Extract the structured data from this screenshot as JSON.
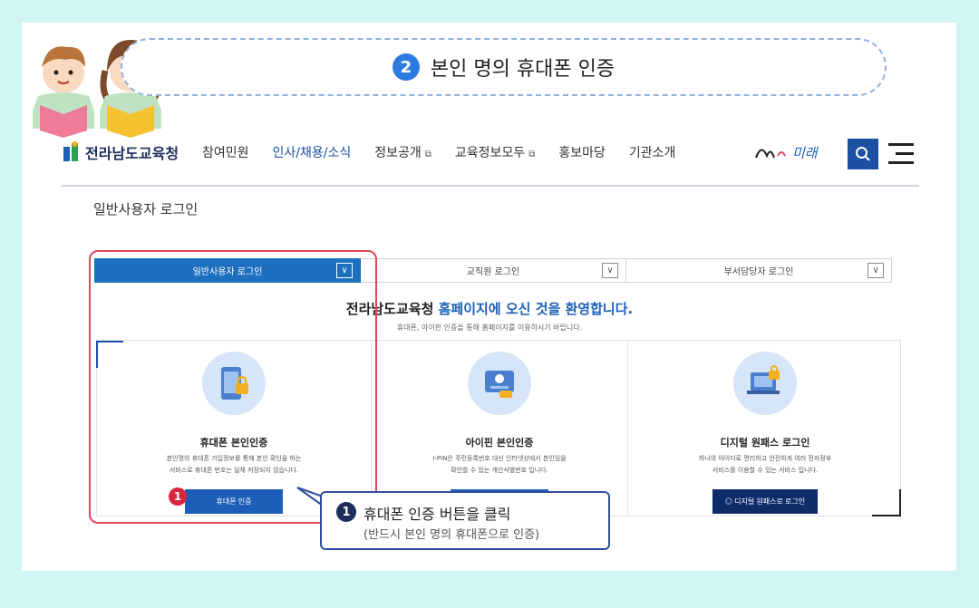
{
  "step": {
    "number": "2",
    "title": "본인 명의 휴대폰 인증"
  },
  "header": {
    "logo_text": "전라남도교육청",
    "nav": [
      {
        "label": "참여민원"
      },
      {
        "label": "인사/채용/소식"
      },
      {
        "label": "정보공개"
      },
      {
        "label": "교육정보모두"
      },
      {
        "label": "홍보마당"
      },
      {
        "label": "기관소개"
      }
    ],
    "brand_text": "미래"
  },
  "page_title": "일반사용자 로그인",
  "tabs": [
    {
      "label": "일반사용자 로그인"
    },
    {
      "label": "교직원 로그인"
    },
    {
      "label": "부서담당자 로그인"
    }
  ],
  "welcome": {
    "prefix": "전라남도교육청",
    "highlight": "홈페이지에 오신 것을 환영합니다.",
    "sub": "휴대폰, 아이핀 인증을 통해 홈페이지를 이용하시기 바랍니다."
  },
  "methods": [
    {
      "title": "휴대폰 본인인증",
      "line1": "본인명의 휴대폰 가입정보를 통해 본인 확인을 하는",
      "line2": "서비스로 휴대폰 번호는 일체 저장되지 않습니다.",
      "button": "휴대폰 인증"
    },
    {
      "title": "아이핀 본인인증",
      "line1": "I-PIN은 주민등록번호 대신 인터넷상에서 본인임을",
      "line2": "확인할 수 있는 개인식별번호 입니다.",
      "button": ""
    },
    {
      "title": "디지털 원패스 로그인",
      "line1": "하나의 아이디로 편리하고 안전하게 여러 전자정부",
      "line2": "서비스를 이용할 수 있는 서비스 입니다.",
      "button": "디지털 원패스로 로그인"
    }
  ],
  "marker": "1",
  "callout": {
    "number": "1",
    "title": "휴대폰 인증 버튼을 클릭",
    "sub": "(반드시 본인 명의 휴대폰으로 인증)"
  },
  "colors": {
    "accent": "#1d4fa3",
    "highlight": "#e0455a",
    "background": "#cff5f5"
  }
}
